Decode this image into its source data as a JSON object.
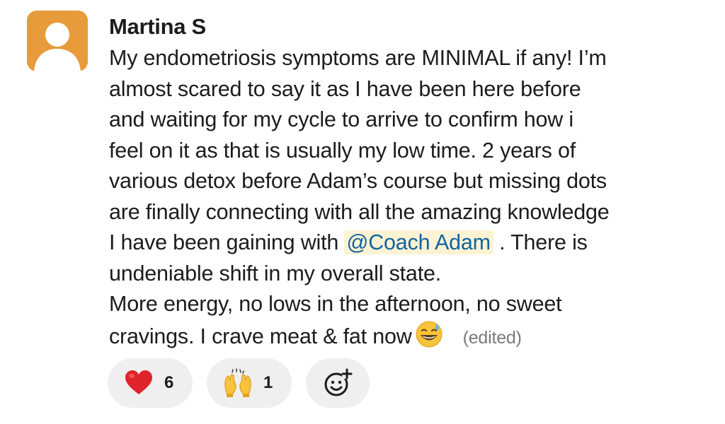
{
  "message": {
    "author": "Martina S",
    "lines": [
      "My endometriosis symptoms are MINIMAL if any! I’m",
      "almost scared to say it as I have been here before",
      "and waiting for my cycle to arrive to confirm how i",
      "feel on it as that is usually my low time. 2 years of",
      "various detox before Adam’s course but missing dots",
      "are finally connecting with all the amazing knowledge"
    ],
    "line7_before": "I have been gaining with ",
    "mention": "@Coach Adam",
    "line7_after": " . There is",
    "line8": "undeniable shift in my overall state.",
    "line9": "More energy, no lows in the afternoon, no sweet",
    "line10": "cravings. I crave meat & fat now",
    "inline_emoji": "grinning-sweat-emoji",
    "edited_label": "(edited)"
  },
  "avatar": {
    "icon": "default-user-avatar",
    "background": "#e89b3a"
  },
  "reactions": [
    {
      "emoji": "red-heart",
      "count": "6"
    },
    {
      "emoji": "raising-hands",
      "count": "1"
    },
    {
      "emoji": "add-reaction",
      "count": ""
    }
  ],
  "colors": {
    "mention_text": "#1264a3",
    "mention_bg": "#fdf3d3",
    "reaction_bg": "#efefef",
    "edited_text": "#7a7a7a"
  }
}
